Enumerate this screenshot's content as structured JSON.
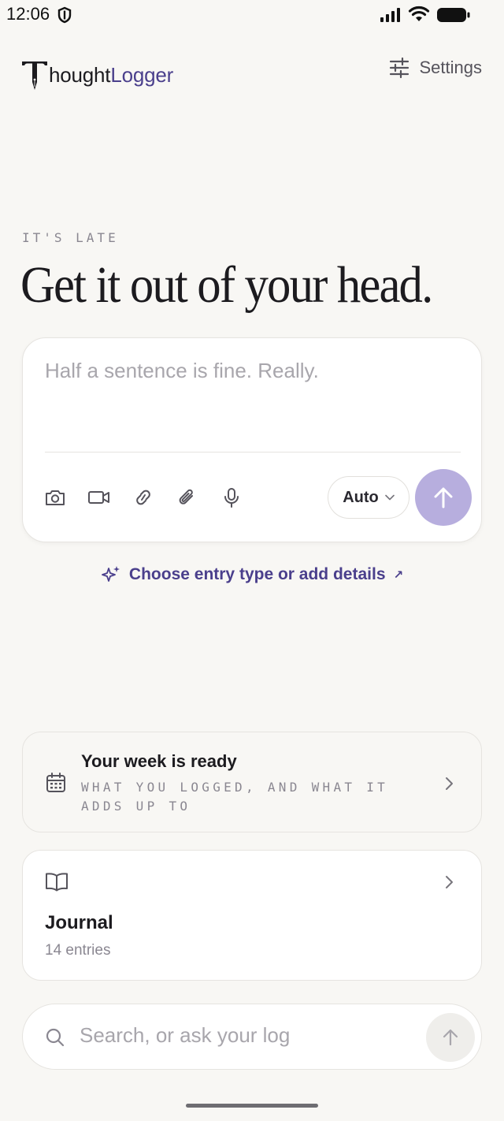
{
  "status_bar": {
    "time": "12:06"
  },
  "header": {
    "logo_part1": "hought",
    "logo_part2": "Logger",
    "settings_label": "Settings"
  },
  "hero": {
    "eyebrow": "IT'S LATE",
    "headline": "Get it out of your head."
  },
  "composer": {
    "placeholder": "Half a sentence is fine. Really.",
    "value": "",
    "tools": [
      "camera-icon",
      "video-icon",
      "link-icon",
      "paperclip-icon",
      "microphone-icon"
    ],
    "mode_label": "Auto"
  },
  "details_link": {
    "label": "Choose entry type or add details",
    "suffix": "↗"
  },
  "week_card": {
    "title": "Your week is ready",
    "subtitle": "WHAT YOU LOGGED, AND WHAT IT ADDS UP TO"
  },
  "journal_card": {
    "title": "Journal",
    "count": "14 entries"
  },
  "search": {
    "placeholder": "Search, or ask your log"
  },
  "colors": {
    "background": "#f8f7f4",
    "brand_purple": "#4a3f8c",
    "send_button": "#b7aede"
  }
}
